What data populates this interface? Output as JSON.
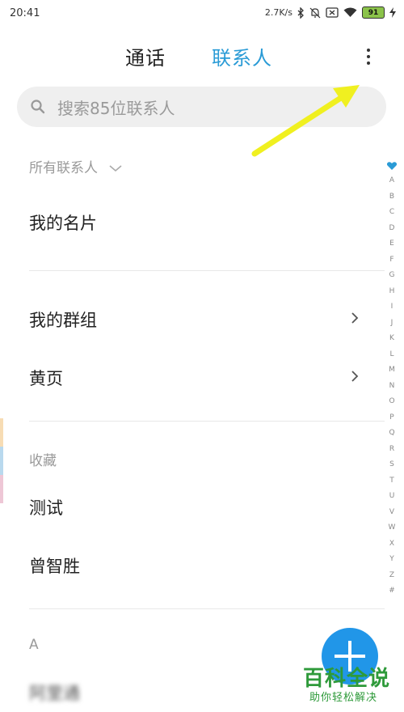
{
  "status": {
    "time": "20:41",
    "speed": "2.7K/s",
    "battery": "91"
  },
  "tabs": {
    "calls": "通话",
    "contacts": "联系人"
  },
  "search": {
    "placeholder": "搜索85位联系人"
  },
  "sections": {
    "all": "所有联系人",
    "my_card": "我的名片",
    "my_groups": "我的群组",
    "yellow_pages": "黄页",
    "favorites": "收藏",
    "fav1": "测试",
    "fav2": "曾智胜",
    "letter_a": "A",
    "blurred_contact": "阿里通"
  },
  "index": [
    "A",
    "B",
    "C",
    "D",
    "E",
    "F",
    "G",
    "H",
    "I",
    "J",
    "K",
    "L",
    "M",
    "N",
    "O",
    "P",
    "Q",
    "R",
    "S",
    "T",
    "U",
    "V",
    "W",
    "X",
    "Y",
    "Z",
    "#"
  ],
  "watermark": {
    "title": "百科全说",
    "subtitle": "助你轻松解决"
  },
  "colors": {
    "accent": "#2a9bd6",
    "fab": "#2196e8",
    "arrow": "#f0f020",
    "watermark": "#2e9a3a"
  }
}
